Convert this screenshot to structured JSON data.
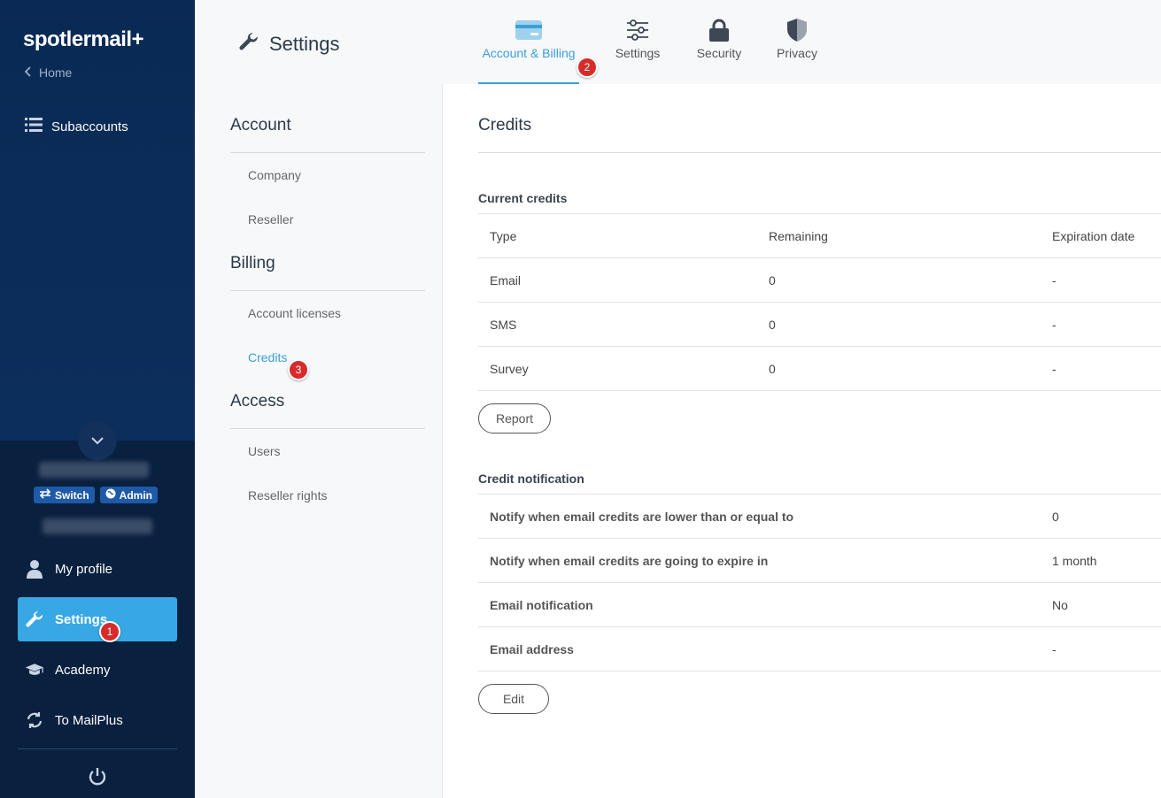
{
  "brand": {
    "logo_text": "spotlermail",
    "logo_plus": "+"
  },
  "sidebar": {
    "home_label": "Home",
    "subaccounts_label": "Subaccounts",
    "badges": {
      "switch": "Switch",
      "admin": "Admin"
    },
    "items": [
      {
        "label": "My profile",
        "icon": "user-icon"
      },
      {
        "label": "Settings",
        "icon": "wrench-icon",
        "active": true
      },
      {
        "label": "Academy",
        "icon": "graduation-cap-icon"
      },
      {
        "label": "To MailPlus",
        "icon": "swap-icon"
      }
    ]
  },
  "header": {
    "title": "Settings",
    "tabs": [
      {
        "label": "Account & Billing",
        "icon": "credit-card-icon",
        "active": true
      },
      {
        "label": "Settings",
        "icon": "sliders-icon"
      },
      {
        "label": "Security",
        "icon": "lock-icon"
      },
      {
        "label": "Privacy",
        "icon": "shield-icon"
      }
    ]
  },
  "subnav": {
    "sections": [
      {
        "title": "Account",
        "links": [
          "Company",
          "Reseller"
        ]
      },
      {
        "title": "Billing",
        "links": [
          "Account licenses",
          "Credits"
        ]
      },
      {
        "title": "Access",
        "links": [
          "Users",
          "Reseller rights"
        ]
      }
    ],
    "active_link": "Credits"
  },
  "steps": [
    "1",
    "2",
    "3"
  ],
  "main": {
    "title": "Credits",
    "current_credits": {
      "heading": "Current credits",
      "columns": [
        "Type",
        "Remaining",
        "Expiration date"
      ],
      "rows": [
        [
          "Email",
          "0",
          "-"
        ],
        [
          "SMS",
          "0",
          "-"
        ],
        [
          "Survey",
          "0",
          "-"
        ]
      ],
      "button": "Report"
    },
    "credit_notification": {
      "heading": "Credit notification",
      "rows": [
        [
          "Notify when email credits are lower than or equal to",
          "0"
        ],
        [
          "Notify when email credits are going to expire in",
          "1 month"
        ],
        [
          "Email notification",
          "No"
        ],
        [
          "Email address",
          "-"
        ]
      ],
      "button": "Edit"
    }
  },
  "colors": {
    "sidebar": "#0c2e5c",
    "accent": "#37a8e4",
    "step_badge": "#d62b2b"
  }
}
